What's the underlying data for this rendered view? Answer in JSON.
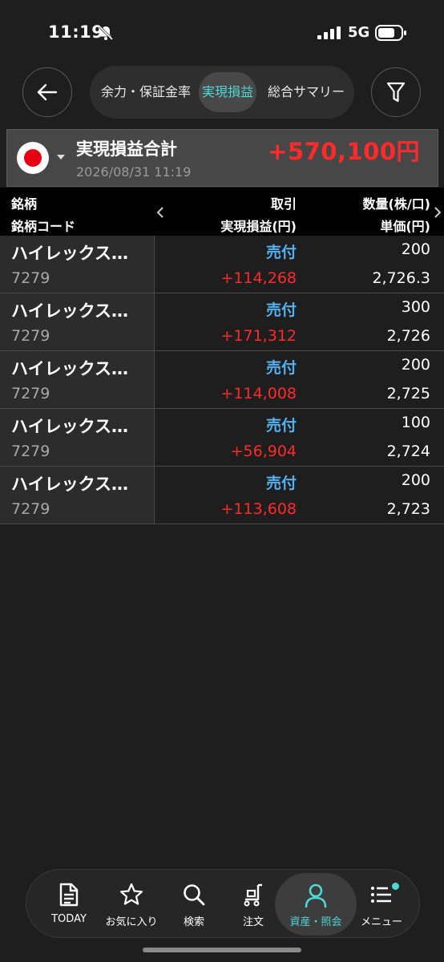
{
  "status": {
    "time": "11:19",
    "network": "5G"
  },
  "segments": [
    {
      "label": "余力・保証金率",
      "active": false
    },
    {
      "label": "実現損益",
      "active": true
    },
    {
      "label": "総合サマリー",
      "active": false
    }
  ],
  "summary": {
    "title": "実現損益合計",
    "date": "2026/08/31 11:19",
    "total": "+570,100円",
    "total_color": "#ff2a2a"
  },
  "table": {
    "headers": {
      "name": "銘柄",
      "code": "銘柄コード",
      "side": "取引",
      "pnl": "実現損益(円)",
      "qty": "数量(株/口)",
      "price": "単価(円)"
    },
    "rows": [
      {
        "name": "ハイレックス…",
        "code": "7279",
        "side": "売付",
        "pnl": "+114,268",
        "qty": "200",
        "price": "2,726.3"
      },
      {
        "name": "ハイレックス…",
        "code": "7279",
        "side": "売付",
        "pnl": "+171,312",
        "qty": "300",
        "price": "2,726"
      },
      {
        "name": "ハイレックス…",
        "code": "7279",
        "side": "売付",
        "pnl": "+114,008",
        "qty": "200",
        "price": "2,725"
      },
      {
        "name": "ハイレックス…",
        "code": "7279",
        "side": "売付",
        "pnl": "+56,904",
        "qty": "100",
        "price": "2,724"
      },
      {
        "name": "ハイレックス…",
        "code": "7279",
        "side": "売付",
        "pnl": "+113,608",
        "qty": "200",
        "price": "2,723"
      }
    ]
  },
  "tabbar": [
    {
      "label": "TODAY",
      "icon": "document-icon",
      "active": false
    },
    {
      "label": "お気に入り",
      "icon": "star-icon",
      "active": false
    },
    {
      "label": "検索",
      "icon": "search-icon",
      "active": false
    },
    {
      "label": "注文",
      "icon": "cart-icon",
      "active": false
    },
    {
      "label": "資産・照会",
      "icon": "person-icon",
      "active": true
    },
    {
      "label": "メニュー",
      "icon": "menu-icon",
      "active": false
    }
  ],
  "colors": {
    "accent": "#4fd6d6",
    "sell": "#55b3f4",
    "profit": "#ff2a2a"
  }
}
